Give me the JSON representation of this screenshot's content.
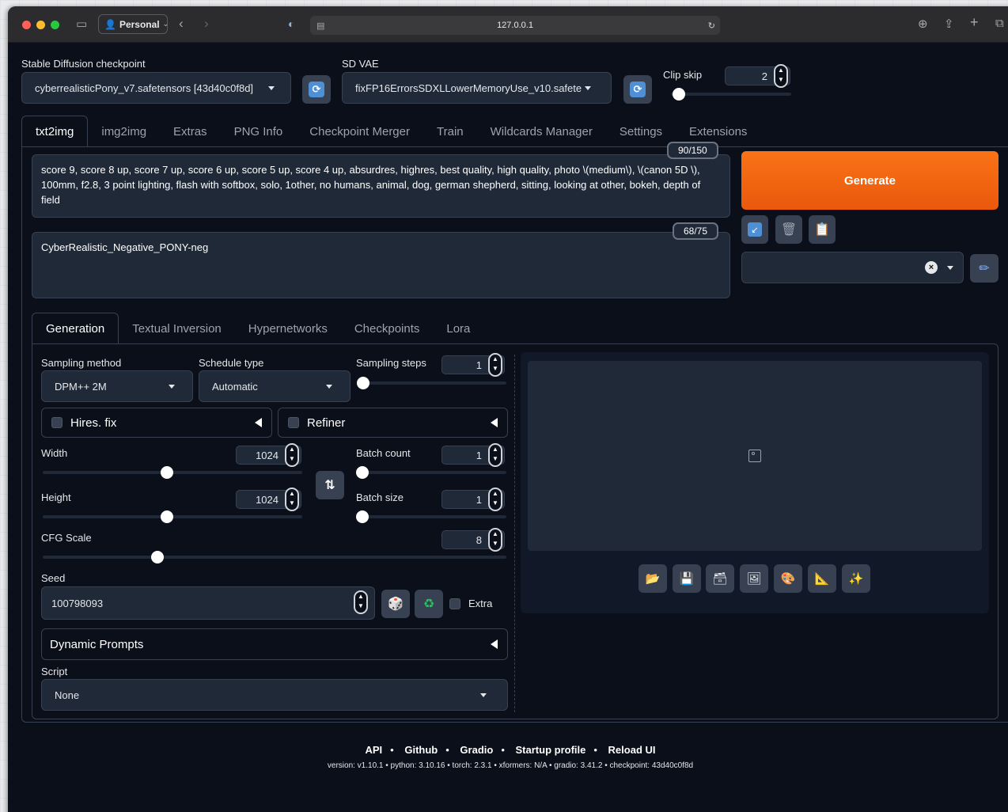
{
  "browser": {
    "profile_label": "Personal",
    "address": "127.0.0.1"
  },
  "top": {
    "checkpoint_label": "Stable Diffusion checkpoint",
    "checkpoint_value": "cyberrealisticPony_v7.safetensors [43d40c0f8d]",
    "vae_label": "SD VAE",
    "vae_value": "fixFP16ErrorsSDXLLowerMemoryUse_v10.safete",
    "clip_skip_label": "Clip skip",
    "clip_skip_value": "2"
  },
  "main_tabs": [
    "txt2img",
    "img2img",
    "Extras",
    "PNG Info",
    "Checkpoint Merger",
    "Train",
    "Wildcards Manager",
    "Settings",
    "Extensions"
  ],
  "prompt": {
    "positive": "score 9, score 8 up, score 7 up, score 6 up, score 5 up, score 4 up, absurdres, highres, best quality, high quality, photo \\(medium\\), \\(canon 5D \\), 100mm, f2.8, 3 point lighting, flash with softbox, solo, 1other, no humans, animal, dog, german shepherd, sitting, looking at other, bokeh, depth of field",
    "positive_counter": "90/150",
    "negative": "CyberRealistic_Negative_PONY-neg",
    "negative_counter": "68/75"
  },
  "generate_label": "Generate",
  "sub_tabs": [
    "Generation",
    "Textual Inversion",
    "Hypernetworks",
    "Checkpoints",
    "Lora"
  ],
  "generation": {
    "sampling_method_label": "Sampling method",
    "sampling_method_value": "DPM++ 2M",
    "schedule_type_label": "Schedule type",
    "schedule_type_value": "Automatic",
    "sampling_steps_label": "Sampling steps",
    "sampling_steps_value": "1",
    "hires_label": "Hires. fix",
    "refiner_label": "Refiner",
    "width_label": "Width",
    "width_value": "1024",
    "height_label": "Height",
    "height_value": "1024",
    "batch_count_label": "Batch count",
    "batch_count_value": "1",
    "batch_size_label": "Batch size",
    "batch_size_value": "1",
    "cfg_label": "CFG Scale",
    "cfg_value": "8",
    "seed_label": "Seed",
    "seed_value": "100798093",
    "extra_label": "Extra",
    "dynamic_prompts_label": "Dynamic Prompts",
    "script_label": "Script",
    "script_value": "None"
  },
  "footer": {
    "links": [
      "API",
      "Github",
      "Gradio",
      "Startup profile",
      "Reload UI"
    ],
    "version_line": "version: v1.10.1  •  python: 3.10.16  •  torch: 2.3.1  •  xformers: N/A  •  gradio: 3.41.2  •  checkpoint: 43d40c0f8d"
  }
}
